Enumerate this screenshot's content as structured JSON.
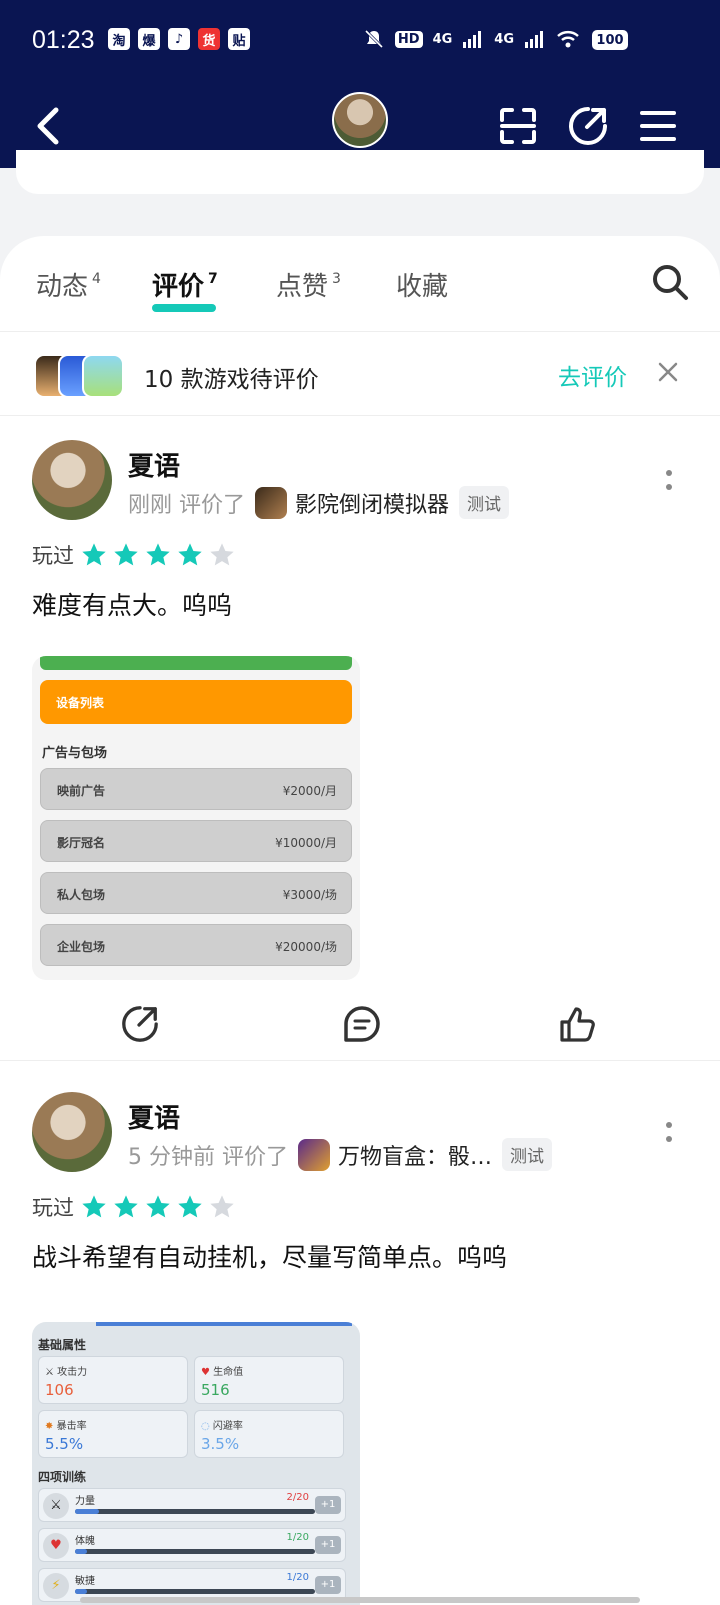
{
  "status": {
    "time": "01:23",
    "battery": "100",
    "network": [
      "4G",
      "4G"
    ]
  },
  "status_icons": [
    "淘",
    "爆",
    "♪",
    "货",
    "贴"
  ],
  "tabs": [
    {
      "label": "动态",
      "count": "4"
    },
    {
      "label": "评价",
      "count": "7"
    },
    {
      "label": "点赞",
      "count": "3"
    },
    {
      "label": "收藏",
      "count": ""
    }
  ],
  "pending": {
    "text": "10 款游戏待评价",
    "action": "去评价"
  },
  "posts": [
    {
      "user": "夏语",
      "time": "刚刚",
      "verb": "评价了",
      "game": "影院倒闭模拟器",
      "badge": "测试",
      "played": "玩过",
      "stars": 4,
      "text": "难度有点大。呜呜",
      "shot": {
        "orange_button": "设备列表",
        "heading": "广告与包场",
        "rows": [
          {
            "label": "映前广告",
            "price": "¥2000/月"
          },
          {
            "label": "影厅冠名",
            "price": "¥10000/月"
          },
          {
            "label": "私人包场",
            "price": "¥3000/场"
          },
          {
            "label": "企业包场",
            "price": "¥20000/场"
          }
        ]
      }
    },
    {
      "user": "夏语",
      "time": "5 分钟前",
      "verb": "评价了",
      "game": "万物盲盒：骰…",
      "badge": "测试",
      "played": "玩过",
      "stars": 4,
      "text": "战斗希望有自动挂机，尽量写简单点。呜呜",
      "shot": {
        "heading1": "基础属性",
        "attrs": [
          {
            "icon": "⚔",
            "label": "攻击力",
            "value": "106",
            "color": "#e8603c"
          },
          {
            "icon": "♥",
            "label": "生命值",
            "value": "516",
            "color": "#3aa860"
          },
          {
            "icon": "✸",
            "label": "暴击率",
            "value": "5.5%",
            "color": "#3a78d6"
          },
          {
            "icon": "◌",
            "label": "闪避率",
            "value": "3.5%",
            "color": "#6aa6e8"
          }
        ],
        "heading2": "四项训练",
        "trainings": [
          {
            "icon": "⚔",
            "label": "力量",
            "value": "2/20",
            "color": "#e04040",
            "plus": "+1",
            "fill": 0.1
          },
          {
            "icon": "♥",
            "label": "体魄",
            "value": "1/20",
            "color": "#3aa860",
            "plus": "+1",
            "fill": 0.05
          },
          {
            "icon": "⚡",
            "label": "敏捷",
            "value": "1/20",
            "color": "#3a78d6",
            "plus": "+1",
            "fill": 0.05
          }
        ]
      }
    }
  ],
  "colors": {
    "header_bg": "#0a1552",
    "accent": "#15c9b8",
    "star_empty": "#d6d9de"
  }
}
